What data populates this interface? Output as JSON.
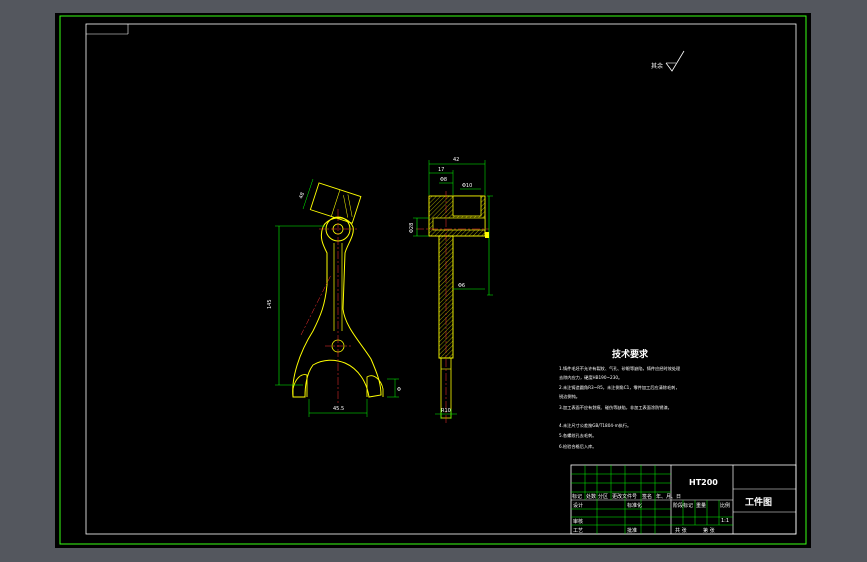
{
  "colors": {
    "viewport_bg": "#000000",
    "outer_frame": "#39ff14",
    "inner_frame": "#ffffff",
    "part_outline": "#ffff00",
    "dimension": "#00ff00",
    "center_line": "#ff3030",
    "hatch": "#ffff00",
    "text": "#ffffff",
    "accent": "#00ffff",
    "frame_gray": "#54575e"
  },
  "surface_symbol": {
    "label": "其余",
    "icon": "surface-roughness-check-icon"
  },
  "dimensions": {
    "top_width": "42",
    "width_17": "17",
    "small_a": "Φ8",
    "small_b": "Φ10",
    "side_height": "Φ28",
    "neck": "Φ6",
    "bottom_width": "R10",
    "foot": "Φ",
    "left_length": "145",
    "angle_label": "48",
    "bottom_span": "45.5"
  },
  "tech_requirements": {
    "title": "技术要求",
    "lines": [
      "1.铸件毛坯不允许有裂纹、气孔、砂眼等缺陷，铸件应经时效处理",
      "去除内应力，硬度HB190~230。",
      "2.未注铸造圆角R3~R5，未注倒角C1，零件加工后应清除毛刺，",
      "锐边倒钝。",
      "3.加工表面不应有划痕、碰伤等缺陷，非加工表面涂防锈漆。",
      "4.未注尺寸公差按GB/T1804-m执行。",
      "5.各螺纹孔去毛刺。",
      "6.检验合格后入库。"
    ]
  },
  "title_block": {
    "material": "HT200",
    "drawing_name": "工件图",
    "row_labels": [
      "标记",
      "处数",
      "分区",
      "更改文件号",
      "签名",
      "年、月、日"
    ],
    "designer": "设计",
    "standardize": "标准化",
    "review": "审核",
    "process": "工艺",
    "approve": "批准",
    "stage_mark": "阶段标记",
    "weight": "重量",
    "scale": "比例",
    "scale_value": "1:1",
    "sheet_total": "共 张",
    "sheet_no": "第 张"
  }
}
